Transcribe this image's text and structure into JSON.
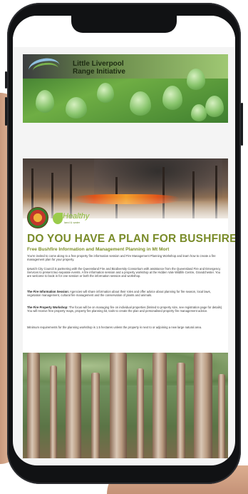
{
  "banner": {
    "org_line1": "Little Liverpool",
    "org_line2": "Range Initiative"
  },
  "flyer": {
    "healthy_logo": "Healthy",
    "healthy_logo_sub": "land & water",
    "headline": "DO YOU HAVE A PLAN FOR BUSHFIRE?",
    "subheadline": "Free Bushfire Information and Management Planning in Mt Mort",
    "para1": "You're invited to come along to a free property fire information session and Fire Management Planning Workshop and learn how to create a fire management plan for your property.",
    "para2": "Ipswich City Council is partnering with the Queensland Fire and Biodiversity Consortium with assistance from the Queensland Fire and Emergency Services to present two separate events. A fire information session and a property workshop at the Hidden Vale Wildlife Centre, Grandchester. You are welcome to book in for one session or both the information session and workshop.",
    "para3_label": "The Fire Information Session:",
    "para3": "Agencies will share information about their roles and offer advice about planning for fire season, local laws, vegetation management, cultural fire management and the conservation of plants and animals.",
    "para4_label": "The Fire Property Workshop:",
    "para4": "The focus will be on managing fire on individual properties (limited to property size, see registration page for details). You will receive free property maps, property fire planning kit, tools to create the plan and personalised property fire management advice.",
    "para5": "Minimum requirements for the planning workshop is 1.5 hectares unless the property is next to or adjoining a new large natural area."
  }
}
